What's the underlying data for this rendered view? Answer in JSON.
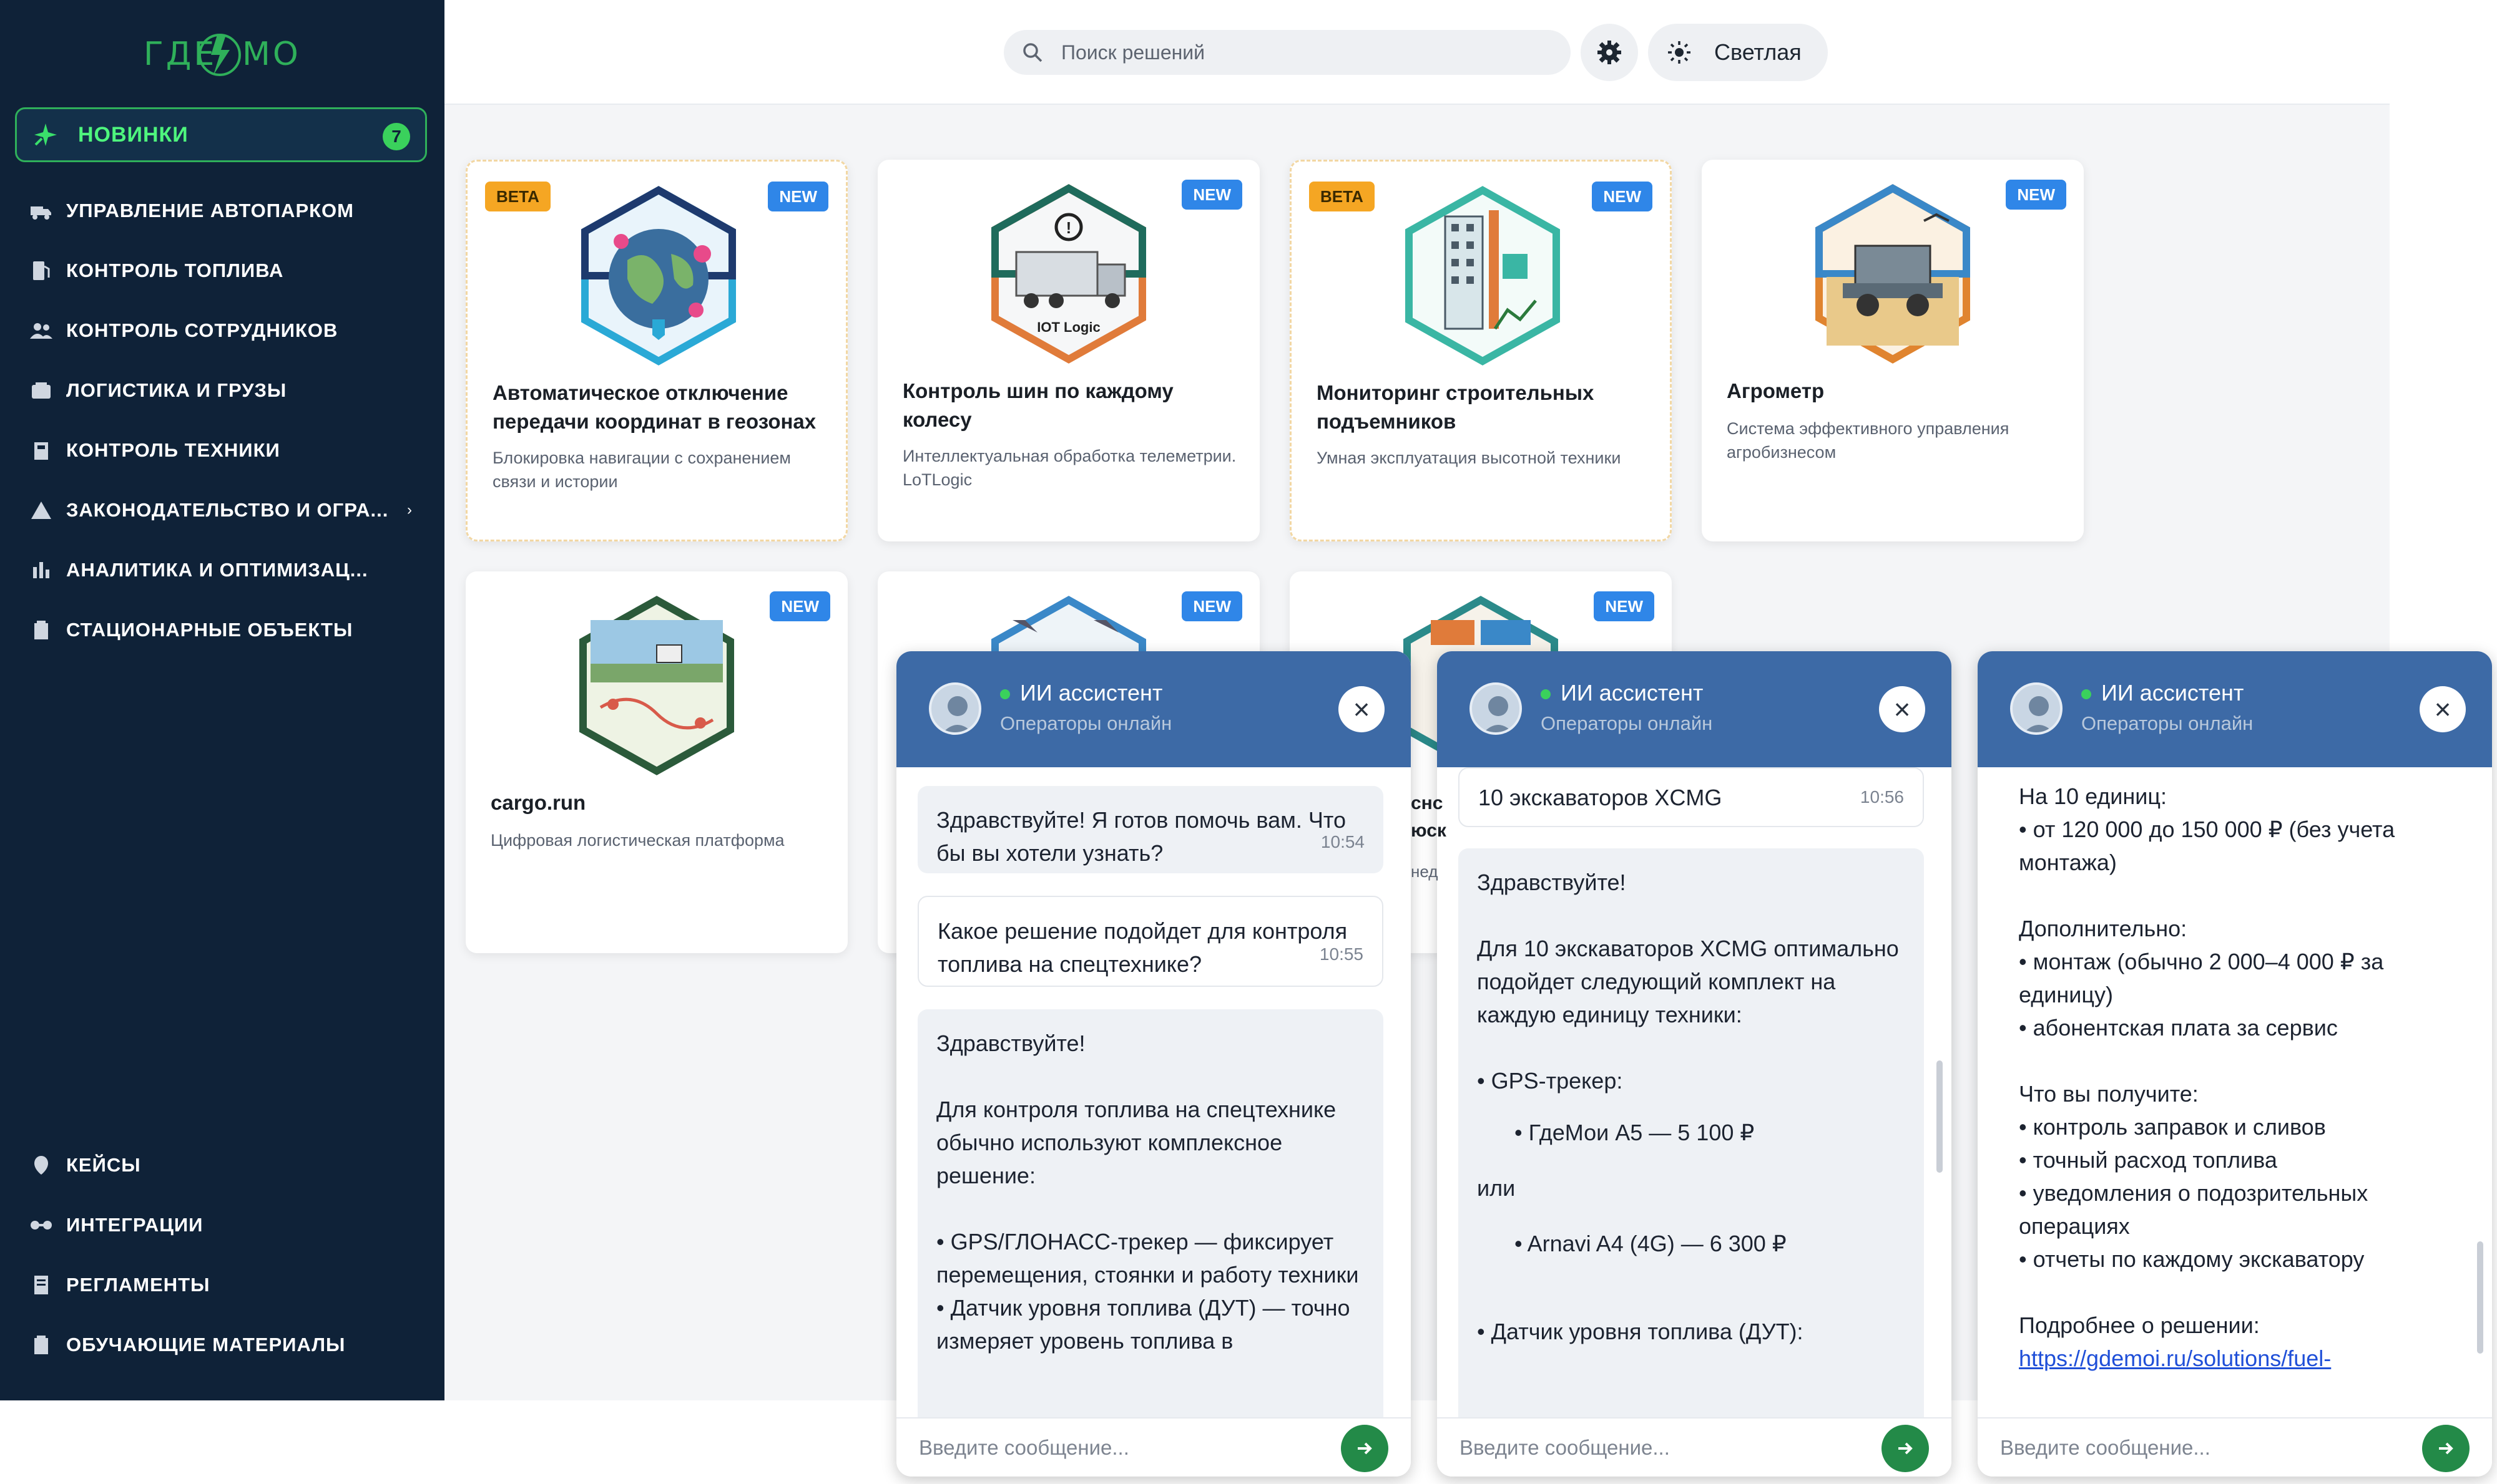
{
  "sidebar": {
    "logo": "ГДЕМОИ",
    "new_item": {
      "label": "НОВИНКИ",
      "count": "7"
    },
    "items": [
      {
        "label": "УПРАВЛЕНИЕ АВТОПАРКОМ",
        "icon": "truck-icon"
      },
      {
        "label": "КОНТРОЛЬ ТОПЛИВА",
        "icon": "fuel-icon"
      },
      {
        "label": "КОНТРОЛЬ СОТРУДНИКОВ",
        "icon": "users-icon"
      },
      {
        "label": "ЛОГИСТИКА И ГРУЗЫ",
        "icon": "box-icon"
      },
      {
        "label": "КОНТРОЛЬ ТЕХНИКИ",
        "icon": "machine-icon"
      },
      {
        "label": "ЗАКОНОДАТЕЛЬСТВО И ОГРА...",
        "icon": "warning-icon"
      },
      {
        "label": "АНАЛИТИКА И ОПТИМИЗАЦ...",
        "icon": "chart-icon"
      },
      {
        "label": "СТАЦИОНАРНЫЕ ОБЪЕКТЫ",
        "icon": "building-icon"
      }
    ],
    "bottom_items": [
      {
        "label": "КЕЙСЫ",
        "icon": "case-icon"
      },
      {
        "label": "ИНТЕГРАЦИИ",
        "icon": "link-icon"
      },
      {
        "label": "РЕГЛАМЕНТЫ",
        "icon": "doc-icon"
      },
      {
        "label": "ОБУЧАЮЩИЕ МАТЕРИАЛЫ",
        "icon": "book-icon"
      }
    ]
  },
  "header": {
    "search_placeholder": "Поиск решений",
    "theme_label": "Светлая"
  },
  "cards": [
    {
      "title": "Автоматическое отключение передачи координат в геозонах",
      "desc": "Блокировка навигации с сохранением связи и истории",
      "tags": [
        "BETA",
        "NEW"
      ]
    },
    {
      "title": "Контроль шин по каждому колесу",
      "desc": "Интеллектуальная обработка телеметрии. LoTLogic",
      "tags": [
        "NEW"
      ],
      "image_text": "IOT Logic"
    },
    {
      "title": "Мониторинг строительных подъемников",
      "desc": "Умная эксплуатация высотной техники",
      "tags": [
        "BETA",
        "NEW"
      ]
    },
    {
      "title": "Агрометр",
      "desc": "Система эффективного управления агробизнесом",
      "tags": [
        "NEW"
      ]
    },
    {
      "title": "cargo.run",
      "desc": "Цифровая логистическая платформа",
      "tags": [
        "NEW"
      ]
    },
    {
      "title": "",
      "desc": "",
      "tags": [
        "NEW"
      ]
    },
    {
      "title": "",
      "desc": "",
      "tags": [
        "NEW"
      ]
    }
  ],
  "card_fragments": {
    "c7_title": "снс\nюск",
    "c7_desc": "нед"
  },
  "chat_common": {
    "title": "ИИ ассистент",
    "status": "Операторы онлайн",
    "input_placeholder": "Введите сообщение..."
  },
  "chat1": {
    "m1": "Здравствуйте! Я готов помочь вам. Что бы вы хотели узнать?",
    "m1_time": "10:54",
    "m2": "Какое решение подойдет для контроля топлива на спецтехнике?",
    "m2_time": "10:55",
    "m3_lines": [
      "Здравствуйте!",
      "",
      "Для контроля топлива на спецтехнике обычно используют комплексное решение:",
      "",
      "• GPS/ГЛОНАСС-трекер — фиксирует перемещения, стоянки и работу техники",
      "• Датчик уровня топлива (ДУТ) — точно измеряет уровень топлива в"
    ]
  },
  "chat2": {
    "m1": "10 экскаваторов XCMG",
    "m1_time": "10:56",
    "greeting": "Здравствуйте!",
    "intro": "Для 10 экскаваторов XCMG оптимально подойдет следующий комплект на каждую единицу техники:",
    "tracker_label": "• GPS-трекер:",
    "option1": "ГдеМои А5 — 5 100 ₽",
    "or": "или",
    "option2": "Arnavi A4 (4G) — 6 300 ₽",
    "dut": "• Датчик уровня топлива (ДУТ):"
  },
  "chat3": {
    "l1": "На 10 единиц:",
    "l2": "• от 120 000 до 150 000 ₽ (без учета монтажа)",
    "l3": "Дополнительно:",
    "l4": "• монтаж (обычно 2 000–4 000 ₽ за единицу)",
    "l5": "• абонентская плата за сервис",
    "l6": "Что вы получите:",
    "l7": "• контроль заправок и сливов",
    "l8": "• точный расход топлива",
    "l9": "• уведомления о подозрительных операциях",
    "l10": "• отчеты по каждому экскаватору",
    "l11": "Подробнее о решении:",
    "link": "https://gdemoi.ru/solutions/fuel-"
  },
  "colors": {
    "sidebar_bg": "#0f2238",
    "accent_green": "#2fb05a",
    "new_blue": "#2f86e8",
    "beta_orange": "#f5a623",
    "chat_header": "#3d6aa6"
  }
}
